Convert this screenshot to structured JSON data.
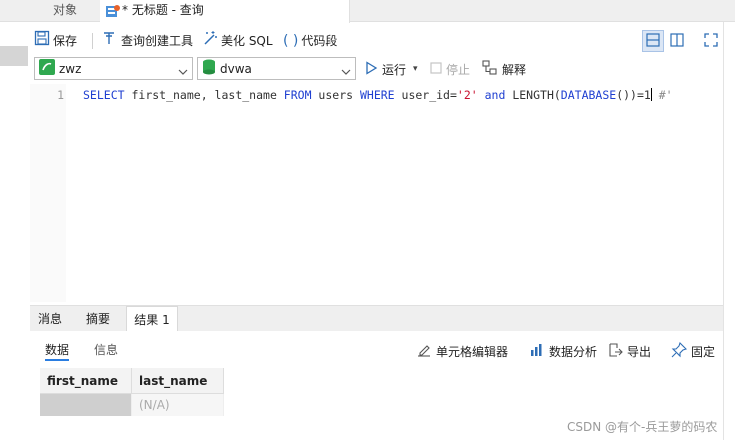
{
  "tabs": {
    "objects": "对象",
    "query": "* 无标题 - 查询"
  },
  "toolbar": {
    "save": "保存",
    "query_builder": "查询创建工具",
    "beautify": "美化 SQL",
    "snippet": "代码段"
  },
  "connection": {
    "server": "zwz",
    "database": "dvwa",
    "run": "运行",
    "stop": "停止",
    "explain": "解释"
  },
  "editor": {
    "line_number": "1",
    "sql": {
      "t1": "SELECT",
      "t2": " first_name, last_name ",
      "t3": "FROM",
      "t4": " users ",
      "t5": "WHERE",
      "t6": " user_id=",
      "t7": "'2'",
      "t8": " ",
      "t9": "and",
      "t10": " LENGTH(",
      "t11": "DATABASE",
      "t12": "())=1",
      "t13": " #'"
    }
  },
  "bottom_panel": {
    "tabs": [
      "消息",
      "摘要",
      "结果 1"
    ],
    "subtabs": [
      "数据",
      "信息"
    ],
    "actions": {
      "cell_editor": "单元格编辑器",
      "data_analysis": "数据分析",
      "export": "导出",
      "pin": "固定"
    }
  },
  "result_grid": {
    "columns": [
      "first_name",
      "last_name"
    ],
    "rows": [
      [
        "",
        "(N/A)"
      ]
    ]
  },
  "watermark": "CSDN @有个-兵王萝的码农",
  "colors": {
    "accent": "#2a7de1",
    "keyword": "#1f3fd1",
    "string": "#c8102e"
  }
}
